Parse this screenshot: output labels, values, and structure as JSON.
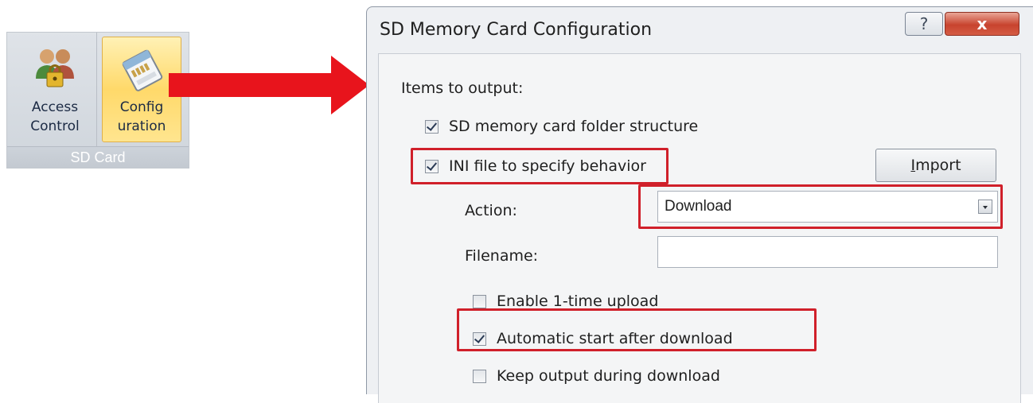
{
  "ribbon": {
    "buttons": [
      {
        "label": "Access\nControl",
        "icon": "users-lock-icon"
      },
      {
        "label": "Config\nuration",
        "icon": "sd-card-icon",
        "selected": true
      }
    ],
    "group_label": "SD Card"
  },
  "dialog": {
    "title": "SD Memory Card Configuration",
    "help_glyph": "?",
    "close_glyph": "x",
    "section_label": "Items to output:",
    "options": {
      "folder_structure": {
        "label": "SD memory card folder structure",
        "checked": true
      },
      "ini_file": {
        "label": "INI file to specify behavior",
        "checked": true
      },
      "enable_upload": {
        "label": "Enable 1-time upload",
        "checked": false
      },
      "auto_start": {
        "label": "Automatic start after download",
        "checked": true
      },
      "keep_output": {
        "label": "Keep output during download",
        "checked": false
      }
    },
    "import_button": {
      "underlined": "I",
      "rest": "mport"
    },
    "action": {
      "label": "Action:",
      "value": "Download"
    },
    "filename": {
      "label": "Filename:",
      "value": ""
    }
  },
  "colors": {
    "highlight": "#d0202a",
    "arrow": "#e8141c",
    "selected_button": "#ffd96a"
  }
}
